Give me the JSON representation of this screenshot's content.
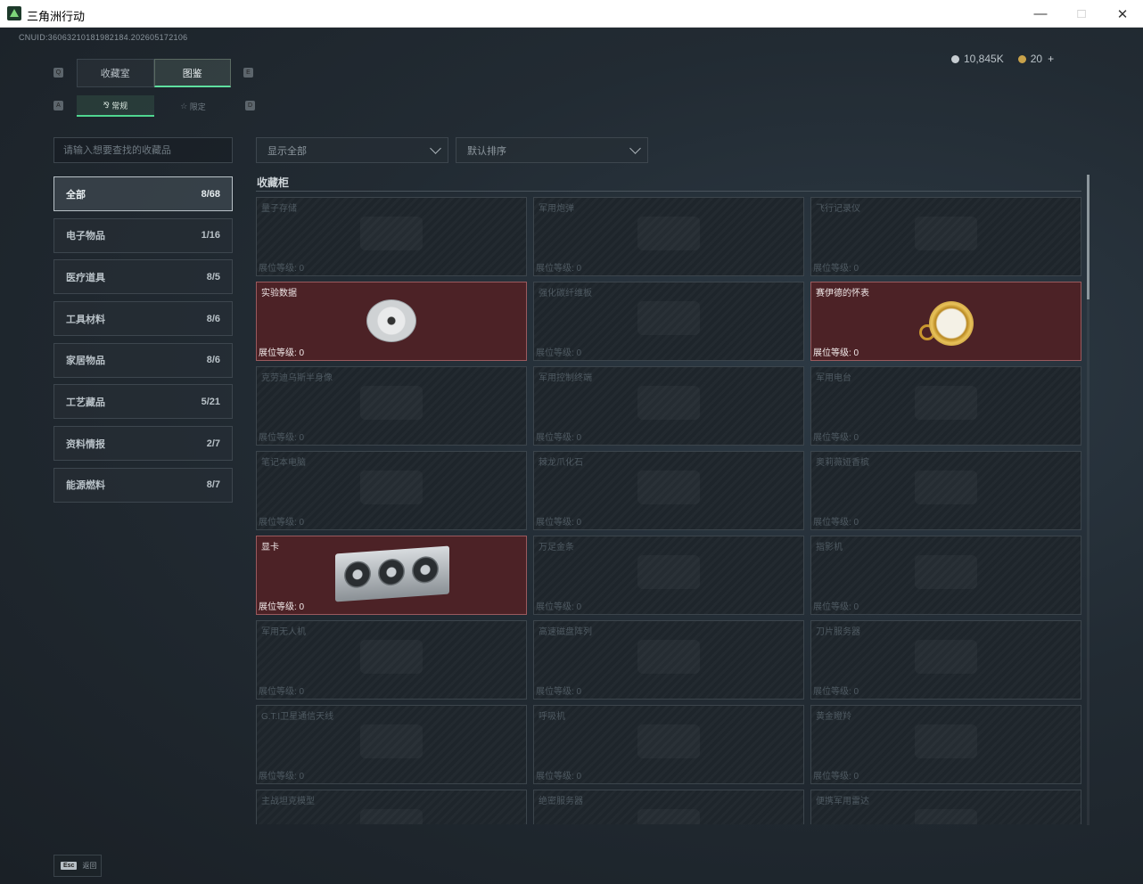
{
  "window": {
    "title": "三角洲行动"
  },
  "player": {
    "uid_text": "CNUID:36063210181982184.202605172106"
  },
  "currency": {
    "silver": "10,845K",
    "gold": "20",
    "add": "+"
  },
  "tabs": {
    "main": [
      {
        "label": "收藏室"
      },
      {
        "label": "图鉴"
      }
    ],
    "sub": [
      {
        "label": "常规"
      },
      {
        "label": "限定"
      }
    ]
  },
  "search": {
    "placeholder": "请输入想要查找的收藏品"
  },
  "filters": {
    "show": "显示全部",
    "sort": "默认排序"
  },
  "categories": [
    {
      "label": "全部",
      "count": "8/68"
    },
    {
      "label": "电子物品",
      "count": "1/16"
    },
    {
      "label": "医疗道具",
      "count": "8/5"
    },
    {
      "label": "工具材料",
      "count": "8/6"
    },
    {
      "label": "家居物品",
      "count": "8/6"
    },
    {
      "label": "工艺藏品",
      "count": "5/21"
    },
    {
      "label": "资料情报",
      "count": "2/7"
    },
    {
      "label": "能源燃料",
      "count": "8/7"
    }
  ],
  "section": {
    "title": "收藏柜"
  },
  "level_label": "展位等级: 0",
  "items": [
    {
      "name": "量子存储"
    },
    {
      "name": "军用炮弹"
    },
    {
      "name": "飞行记录仪"
    },
    {
      "name": "实验数据"
    },
    {
      "name": "强化碳纤维板"
    },
    {
      "name": "赛伊德的怀表"
    },
    {
      "name": "克劳迪乌斯半身像"
    },
    {
      "name": "军用控制终端"
    },
    {
      "name": "军用电台"
    },
    {
      "name": "笔记本电脑"
    },
    {
      "name": "棘龙爪化石"
    },
    {
      "name": "奥莉薇娅香槟"
    },
    {
      "name": "显卡"
    },
    {
      "name": "万足金条"
    },
    {
      "name": "指影机"
    },
    {
      "name": "军用无人机"
    },
    {
      "name": "高速磁盘阵列"
    },
    {
      "name": "刀片服务器"
    },
    {
      "name": "G.T.I卫星通信天线"
    },
    {
      "name": "呼吸机"
    },
    {
      "name": "黄金瞪羚"
    },
    {
      "name": "主战坦克模型"
    },
    {
      "name": "绝密服务器"
    },
    {
      "name": "便携军用雷达"
    }
  ],
  "footer": {
    "key": "Esc",
    "label": "返回"
  }
}
